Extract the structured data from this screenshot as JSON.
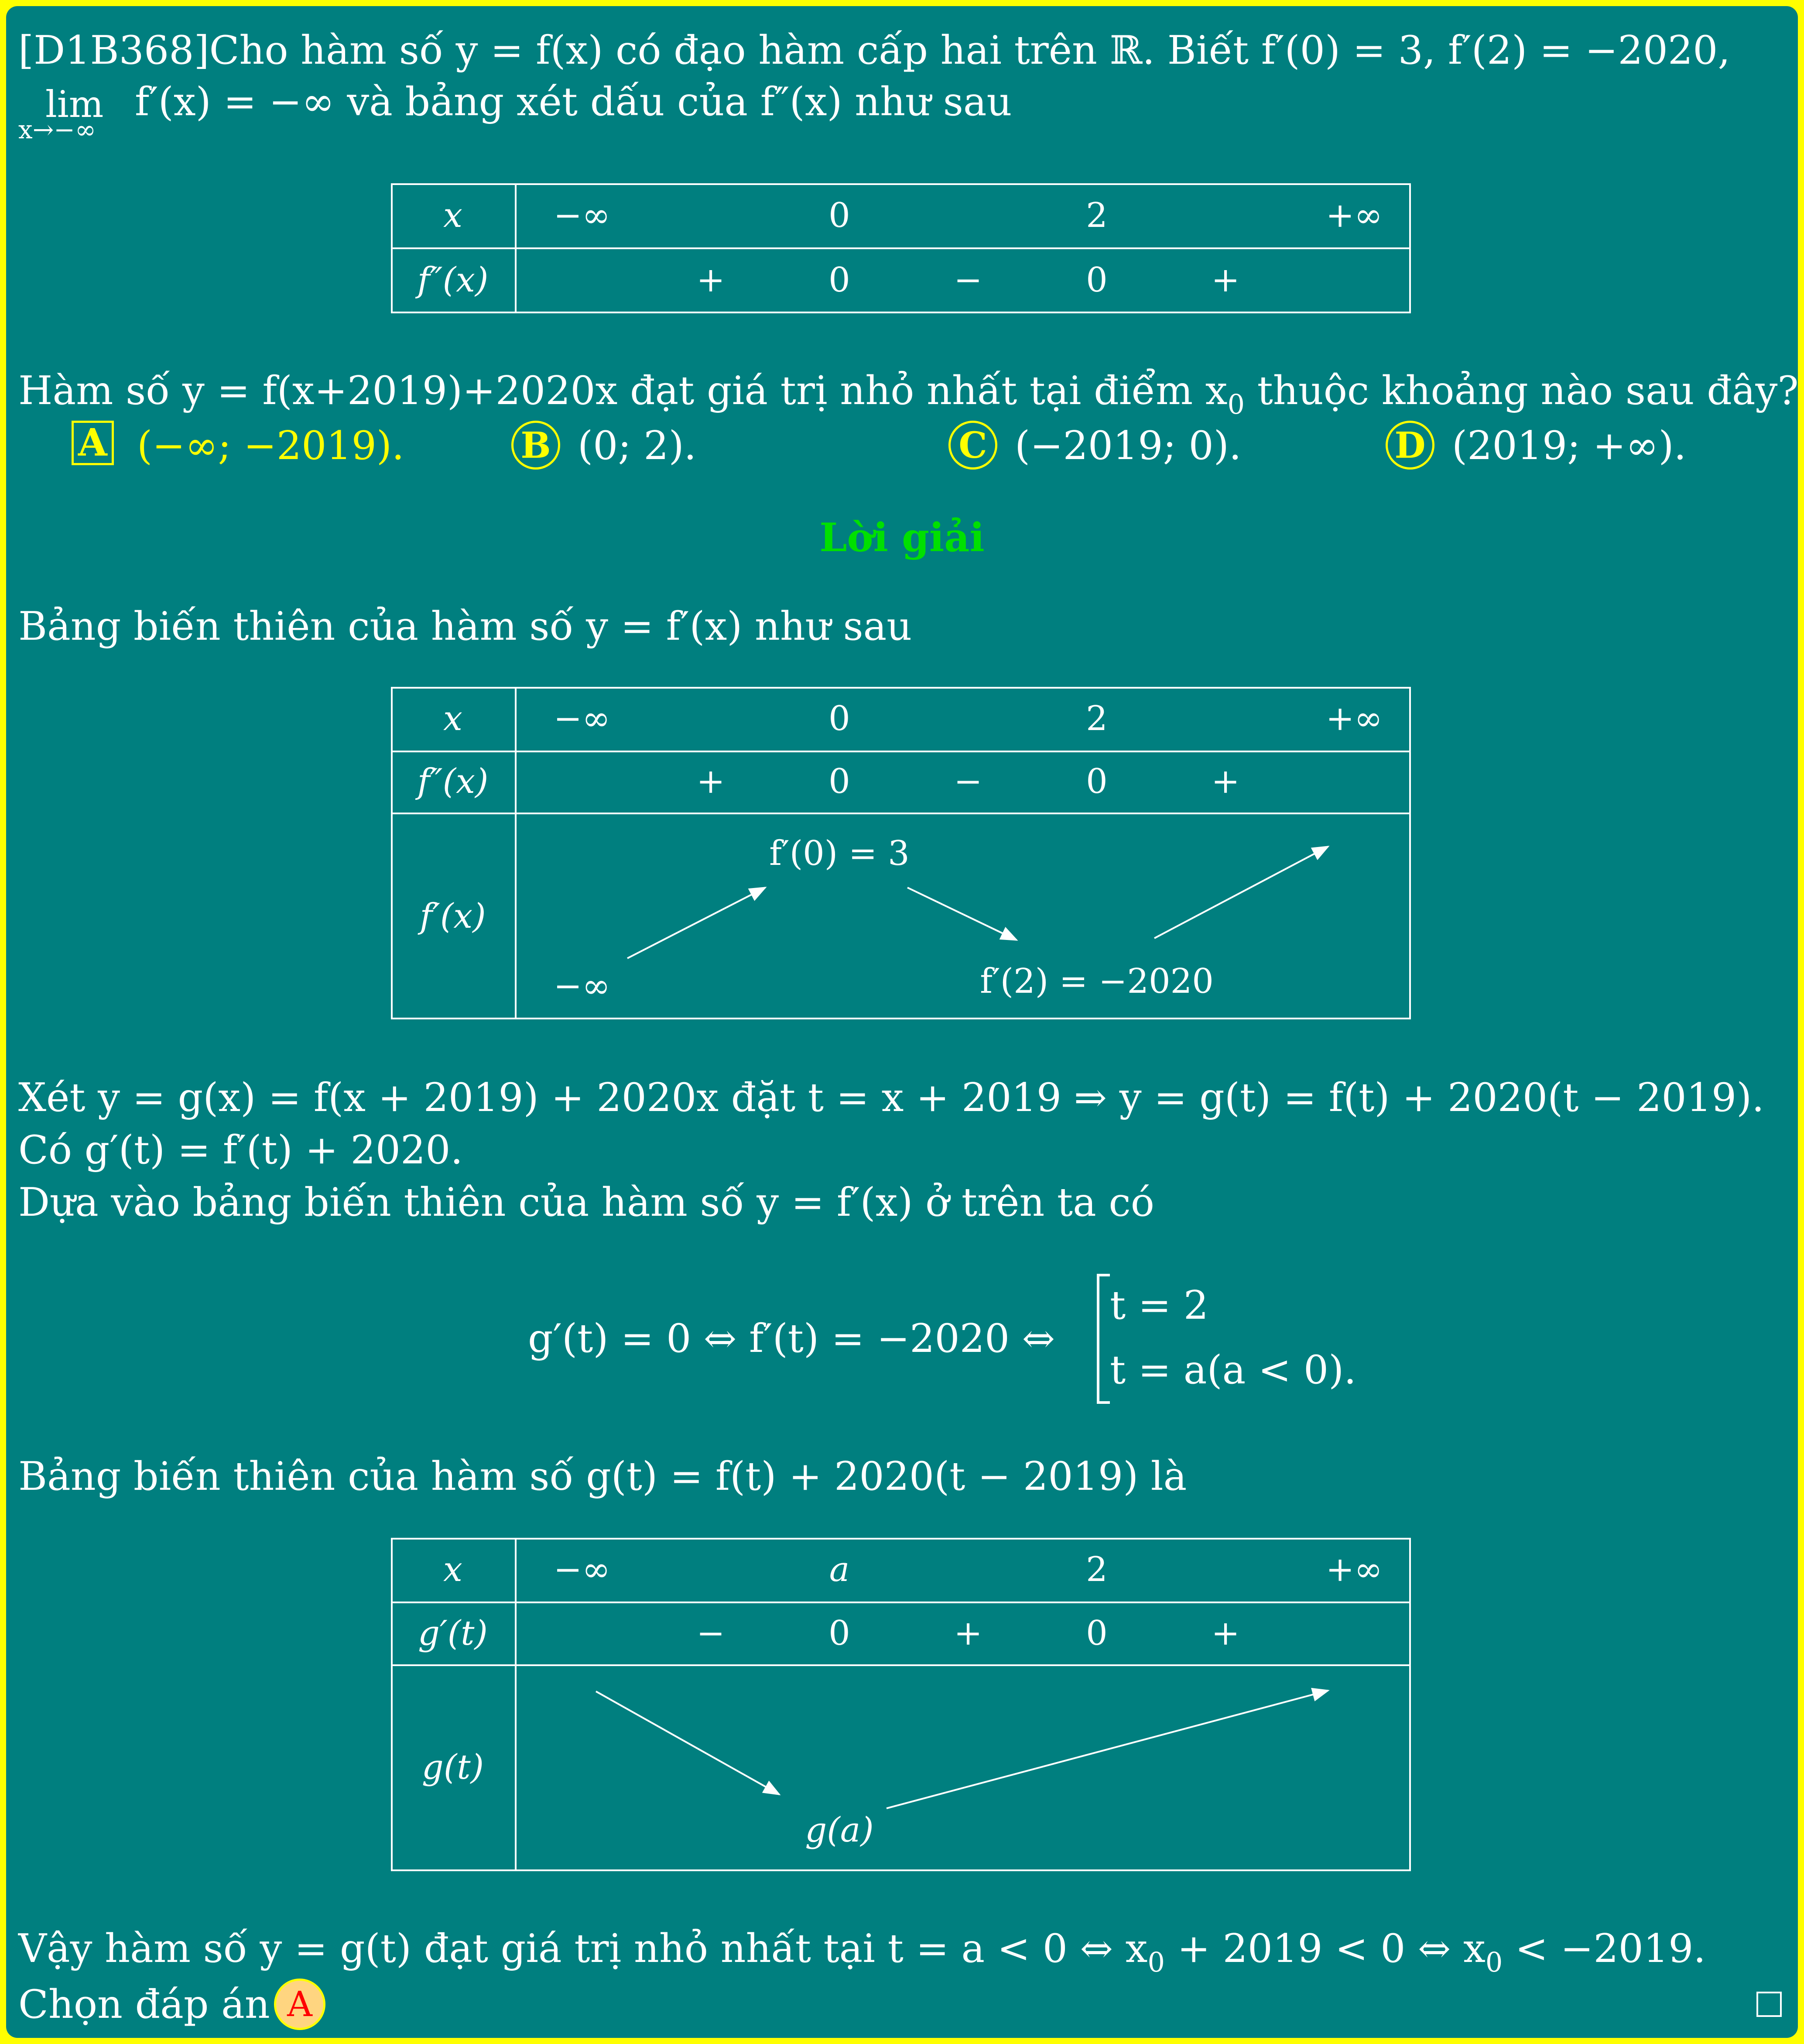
{
  "question": {
    "line1": "[D1B368]Cho hàm số y = f(x) có đạo hàm cấp hai trên ℝ. Biết f′(0) = 3, f′(2) = −2020,",
    "line2_lim": "lim",
    "line2_sub": "x→−∞",
    "line2_rest": "f′(x) = −∞ và bảng xét dấu của f″(x) như sau",
    "line3": "Hàm số y = f(x+2019)+2020x đạt giá trị nhỏ nhất tại điểm x",
    "line3_sub": "0",
    "line3_end": " thuộc khoảng nào sau đây?"
  },
  "sign_table": {
    "x_label": "x",
    "x_values": [
      "−∞",
      "0",
      "2",
      "+∞"
    ],
    "row_label": "f″(x)",
    "signs": [
      "+",
      "0",
      "−",
      "0",
      "+"
    ]
  },
  "answers": [
    {
      "letter": "A",
      "text": "(−∞; −2019)."
    },
    {
      "letter": "B",
      "text": "(0; 2)."
    },
    {
      "letter": "C",
      "text": "(−2019; 0)."
    },
    {
      "letter": "D",
      "text": "(2019; +∞)."
    }
  ],
  "solution_title": "Lời giải",
  "solution": {
    "p1": "Bảng biến thiên của hàm số y = f′(x) như sau",
    "p2": "Xét y = g(x) = f(x + 2019) + 2020x đặt t = x + 2019 ⇒ y = g(t) = f(t) + 2020(t − 2019).",
    "p3": "Có g′(t) = f′(t) + 2020.",
    "p4": "Dựa vào bảng biến thiên của hàm số y = f′(x) ở trên ta có",
    "eq_left": "g′(t) = 0 ⇔ f′(t) = −2020 ⇔",
    "eq_case1": "t = 2",
    "eq_case2": "t = a(a < 0).",
    "p5": "Bảng biến thiên của hàm số g(t) = f(t) + 2020(t − 2019) là",
    "p6_a": "Vậy hàm số y = g(t) đạt giá trị nhỏ nhất tại t = a < 0 ⇔ x",
    "p6_sub1": "0",
    "p6_b": " + 2019 < 0 ⇔ x",
    "p6_sub2": "0",
    "p6_c": " < −2019.",
    "p7": "Chọn đáp án",
    "final_answer": "A"
  },
  "variation_table_1": {
    "x_label": "x",
    "x_values": [
      "−∞",
      "0",
      "2",
      "+∞"
    ],
    "sign_label": "f″(x)",
    "signs": [
      "+",
      "0",
      "−",
      "0",
      "+"
    ],
    "func_label": "f′(x)",
    "values": [
      "−∞",
      "f′(0) = 3",
      "f′(2) = −2020"
    ]
  },
  "variation_table_2": {
    "x_label": "x",
    "x_values": [
      "−∞",
      "a",
      "2",
      "+∞"
    ],
    "sign_label": "g′(t)",
    "signs": [
      "−",
      "0",
      "+",
      "0",
      "+"
    ],
    "func_label": "g(t)",
    "values": [
      "g(a)"
    ]
  },
  "colors": {
    "background": "#007f7f",
    "frame": "#ffff00",
    "title": "#00e000",
    "answer_badge": "#ffd580"
  }
}
